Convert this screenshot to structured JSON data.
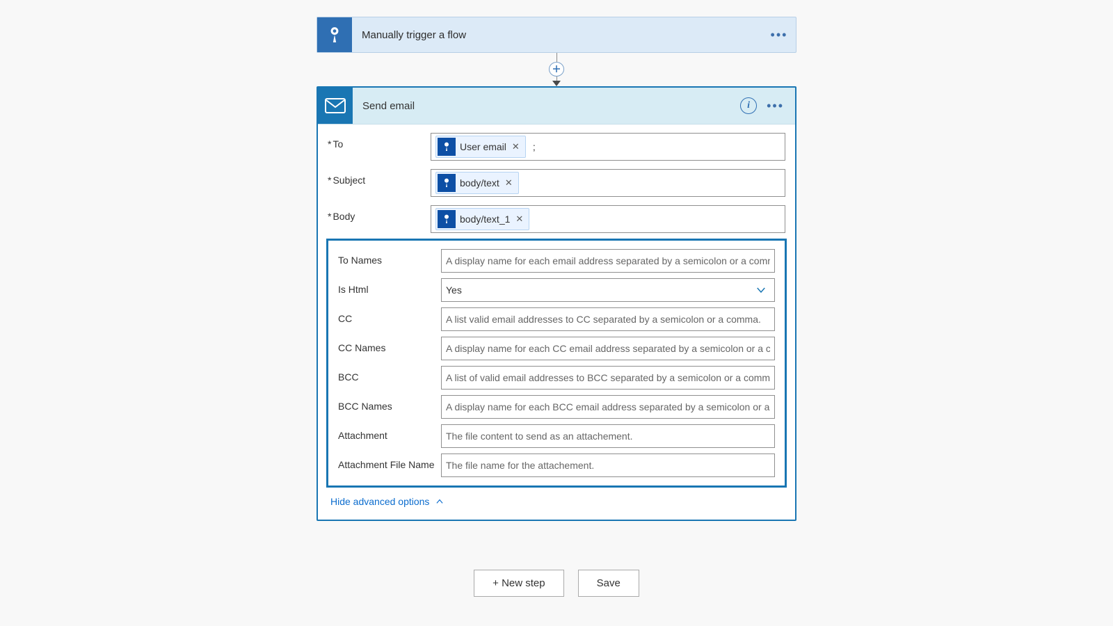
{
  "trigger": {
    "title": "Manually trigger a flow"
  },
  "action": {
    "title": "Send email",
    "fields": {
      "to": {
        "label": "To",
        "token": "User email",
        "after": ";"
      },
      "subject": {
        "label": "Subject",
        "token": "body/text"
      },
      "body": {
        "label": "Body",
        "token": "body/text_1"
      }
    },
    "advanced": {
      "to_names": {
        "label": "To Names",
        "placeholder": "A display name for each email address separated by a semicolon or a comma."
      },
      "is_html": {
        "label": "Is Html",
        "value": "Yes"
      },
      "cc": {
        "label": "CC",
        "placeholder": "A list valid email addresses to CC separated by a semicolon or a comma."
      },
      "cc_names": {
        "label": "CC Names",
        "placeholder": "A display name for each CC email address separated by a semicolon or a comma."
      },
      "bcc": {
        "label": "BCC",
        "placeholder": "A list of valid email addresses to BCC separated by a semicolon or a comma."
      },
      "bcc_names": {
        "label": "BCC Names",
        "placeholder": "A display name for each BCC email address separated by a semicolon or a comma."
      },
      "attachment": {
        "label": "Attachment",
        "placeholder": "The file content to send as an attachement."
      },
      "attachment_file_name": {
        "label": "Attachment File Name",
        "placeholder": "The file name for the attachement."
      }
    },
    "hide_advanced": "Hide advanced options"
  },
  "footer": {
    "new_step": "+ New step",
    "save": "Save"
  }
}
